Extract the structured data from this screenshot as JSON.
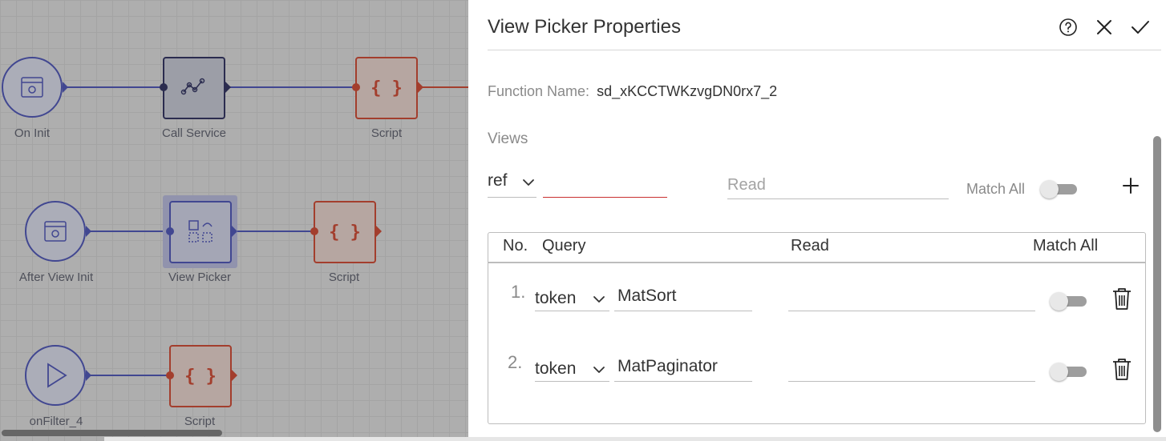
{
  "colors": {
    "accent_blue": "#5b63c9",
    "script_red": "#e2563f",
    "error_red": "#c93030",
    "label_gray": "#8a8a8a"
  },
  "canvas": {
    "nodes": [
      {
        "label": "On Init",
        "kind": "event",
        "icon": "calendar-icon"
      },
      {
        "label": "Call Service",
        "kind": "service",
        "icon": "network-graph-icon"
      },
      {
        "label": "Script",
        "kind": "script",
        "icon": "braces-icon"
      },
      {
        "label": "After View Init",
        "kind": "event",
        "icon": "calendar-icon"
      },
      {
        "label": "View Picker",
        "kind": "view-picker",
        "icon": "swap-frames-icon"
      },
      {
        "label": "Script",
        "kind": "script",
        "icon": "braces-icon"
      },
      {
        "label": "onFilter_4",
        "kind": "event",
        "icon": "play-icon"
      },
      {
        "label": "Script",
        "kind": "script",
        "icon": "braces-icon"
      }
    ],
    "braces_glyph": "{ }"
  },
  "panel": {
    "title": "View Picker Properties",
    "icons": {
      "help": "help-icon",
      "close": "close-icon",
      "confirm": "check-icon"
    },
    "function_name_label": "Function Name:",
    "function_name_value": "sd_xKCCTWKzvgDN0rx7_2",
    "views_label": "Views",
    "new_row": {
      "type_value": "ref",
      "query_value": "",
      "read_placeholder": "Read",
      "match_all_label": "Match All",
      "match_all_on": false
    },
    "table": {
      "headers": {
        "no": "No.",
        "query": "Query",
        "read": "Read",
        "match_all": "Match All"
      },
      "rows": [
        {
          "no": "1.",
          "type": "token",
          "query": "MatSort",
          "read": "",
          "match_all": false
        },
        {
          "no": "2.",
          "type": "token",
          "query": "MatPaginator",
          "read": "",
          "match_all": false
        }
      ]
    }
  }
}
